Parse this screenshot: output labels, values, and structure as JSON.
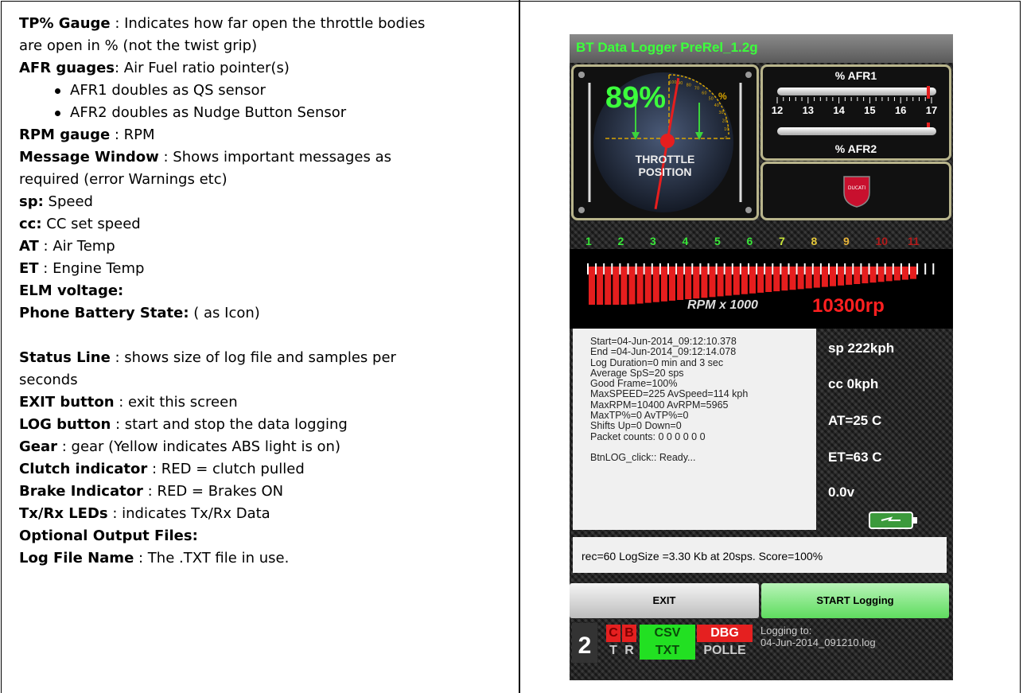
{
  "left_text": [
    {
      "b": "TP% Gauge",
      "t": " : Indicates how far open the throttle bodies"
    },
    {
      "b": "",
      "t": "are open in % (not the twist grip)"
    },
    {
      "b": "AFR guages",
      "t": ": Air Fuel ratio pointer(s)"
    },
    {
      "bullet": true,
      "t": "AFR1 doubles as QS sensor"
    },
    {
      "bullet": true,
      "t": "AFR2 doubles as Nudge Button Sensor"
    },
    {
      "b": "RPM gauge",
      "t": " : RPM"
    },
    {
      "b": "Message Window",
      "t": " : Shows important messages as"
    },
    {
      "b": "",
      "t": "required (error Warnings etc)"
    },
    {
      "b": "sp:",
      "t": " Speed"
    },
    {
      "b": "cc:",
      "t": " CC set speed"
    },
    {
      "b": "AT",
      "t": " : Air Temp"
    },
    {
      "b": "ET",
      "t": " : Engine Temp"
    },
    {
      "b": "ELM voltage:",
      "t": ""
    },
    {
      "b": "Phone Battery State:",
      "t": " ( as Icon)"
    },
    {
      "gap": true
    },
    {
      "b": "Status Line",
      "t": " : shows size of log file and samples per"
    },
    {
      "b": "",
      "t": "seconds"
    },
    {
      "b": "EXIT button",
      "t": " : exit this screen"
    },
    {
      "b": "LOG button",
      "t": " : start and stop the data logging"
    },
    {
      "b": "Gear",
      "t": "  : gear (Yellow indicates ABS light is on)"
    },
    {
      "b": "Clutch indicator",
      "t": " : RED = clutch pulled"
    },
    {
      "b": "Brake Indicator",
      "t": " :  RED = Brakes ON"
    },
    {
      "b": "Tx/Rx LEDs",
      "t": " : indicates Tx/Rx  Data"
    },
    {
      "b": "Optional Output Files:",
      "t": ""
    },
    {
      "b": "Log File Name",
      "t": " : The .TXT  file in use."
    }
  ],
  "app": {
    "title": "BT Data Logger PreRel_1.2g",
    "tp_value": "89%",
    "tp_percent": 89,
    "tp_sign": "%",
    "tp_label_1": "THROTTLE",
    "tp_label_2": "POSITION",
    "tp_scale": [
      "100",
      "90",
      "80",
      "70",
      "60",
      "50",
      "40",
      "30",
      "20",
      "10",
      "0"
    ],
    "afr1_label": "% AFR1",
    "afr2_label": "% AFR2",
    "afr_ticks": [
      "12",
      "13",
      "14",
      "15",
      "16",
      "17"
    ],
    "afr1_value": 16.9,
    "afr2_value": 16.9,
    "logo_text": "DUCATI",
    "gears": [
      {
        "n": "1",
        "c": "#39e639"
      },
      {
        "n": "2",
        "c": "#39e639"
      },
      {
        "n": "3",
        "c": "#39e639"
      },
      {
        "n": "4",
        "c": "#39e639"
      },
      {
        "n": "5",
        "c": "#39e639"
      },
      {
        "n": "6",
        "c": "#39e639"
      },
      {
        "n": "7",
        "c": "#c8e639"
      },
      {
        "n": "8",
        "c": "#e6c839"
      },
      {
        "n": "9",
        "c": "#e6b339"
      },
      {
        "n": "10",
        "c": "#b31a1a"
      },
      {
        "n": "11",
        "c": "#b31a1a"
      }
    ],
    "rpm_label": "RPM x 1000",
    "rpm_value": "10300rp",
    "rpm_fill_ticks": 41,
    "rpm_total_ticks": 44,
    "messages": [
      "Start=04-Jun-2014_09:12:10.378",
      "End  =04-Jun-2014_09:12:14.078",
      "Log Duration=0 min and 3 sec",
      "Average SpS=20 sps",
      "Good Frame=100%",
      "MaxSPEED=225 AvSpeed=114 kph",
      "MaxRPM=10400 AvRPM=5965",
      "MaxTP%=0 AvTP%=0",
      "Shifts Up=0 Down=0",
      "Packet counts: 0 0 0 0 0 0",
      "",
      "BtnLOG_click:: Ready..."
    ],
    "speed": "sp 222kph",
    "cc": "cc 0kph",
    "air_temp": "AT=25 C",
    "engine_temp": "ET=63 C",
    "voltage": "0.0v",
    "status_line": "rec=60 LogSize =3.30 Kb at 20sps. Score=100%",
    "exit_label": "EXIT",
    "log_label": "START Logging",
    "gear": "2",
    "clutch": "C",
    "brake": "B",
    "tx": "T",
    "rx": "R",
    "csv": "CSV",
    "txt": "TXT",
    "dbg": "DBG",
    "polle": "POLLE",
    "logging_to_label": "Logging to:",
    "log_file": "04-Jun-2014_091210.log",
    "colors": {
      "green_title": "#3cff3c",
      "rpm_red": "#ff2020",
      "led_red": "#e52020",
      "led_green": "#22e022"
    }
  }
}
